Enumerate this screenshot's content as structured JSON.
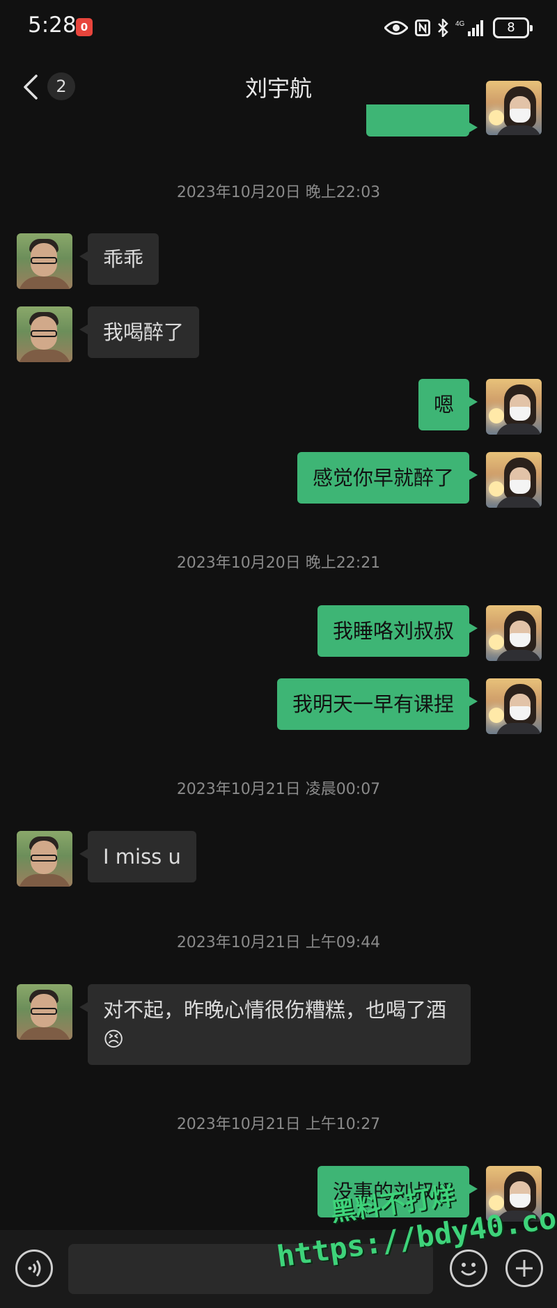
{
  "status_bar": {
    "time": "5:28",
    "notification_badge": "0",
    "battery": "8",
    "network": "4G"
  },
  "header": {
    "title": "刘宇航",
    "unread": "2"
  },
  "messages": [
    {
      "type": "time",
      "text": "2023年10月20日 晚上22:03"
    },
    {
      "type": "in",
      "text": "乖乖"
    },
    {
      "type": "in",
      "text": "我喝醉了"
    },
    {
      "type": "out",
      "text": "嗯"
    },
    {
      "type": "out",
      "text": "感觉你早就醉了"
    },
    {
      "type": "time",
      "text": "2023年10月20日 晚上22:21"
    },
    {
      "type": "out",
      "text": "我睡咯刘叔叔"
    },
    {
      "type": "out",
      "text": "我明天一早有课捏"
    },
    {
      "type": "time",
      "text": "2023年10月21日 凌晨00:07"
    },
    {
      "type": "in",
      "text": "I miss u"
    },
    {
      "type": "time",
      "text": "2023年10月21日 上午09:44"
    },
    {
      "type": "in",
      "text": "对不起，昨晚心情很伤糟糕，也喝了酒😣"
    },
    {
      "type": "time",
      "text": "2023年10月21日 上午10:27"
    },
    {
      "type": "out",
      "text": "没事的刘叔叔"
    }
  ],
  "input": {
    "placeholder": ""
  },
  "watermark": {
    "line1": "黑料不打烊",
    "line2": "https://bdy40.co"
  },
  "icons": [
    "eye-icon",
    "nfc-icon",
    "bluetooth-icon",
    "signal-icon",
    "battery-icon",
    "back-icon",
    "more-icon",
    "voice-icon",
    "emoji-icon",
    "plus-icon"
  ]
}
